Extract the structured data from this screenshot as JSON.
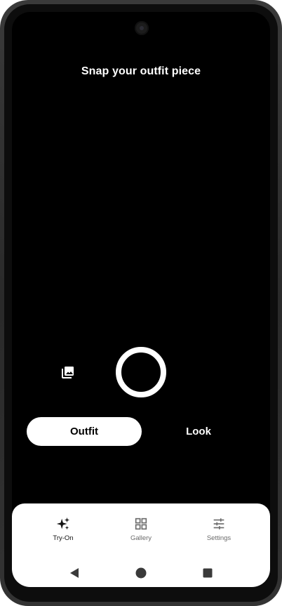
{
  "screen": {
    "title": "Snap your outfit piece"
  },
  "capture": {
    "gallery_icon": "photo-library-icon",
    "shutter_icon": "shutter-ring"
  },
  "modes": {
    "outfit_label": "Outfit",
    "look_label": "Look",
    "selected": "Outfit"
  },
  "bottom_nav": {
    "items": [
      {
        "label": "Try-On",
        "icon": "sparkles-icon",
        "active": true
      },
      {
        "label": "Gallery",
        "icon": "grid-icon",
        "active": false
      },
      {
        "label": "Settings",
        "icon": "sliders-icon",
        "active": false
      }
    ]
  },
  "system_nav": {
    "back_icon": "back-triangle-icon",
    "home_icon": "home-circle-icon",
    "recents_icon": "recents-square-icon"
  },
  "colors": {
    "background": "#000000",
    "accent": "#ffffff",
    "nav_active": "#111111",
    "nav_inactive": "#6b6b6b"
  }
}
